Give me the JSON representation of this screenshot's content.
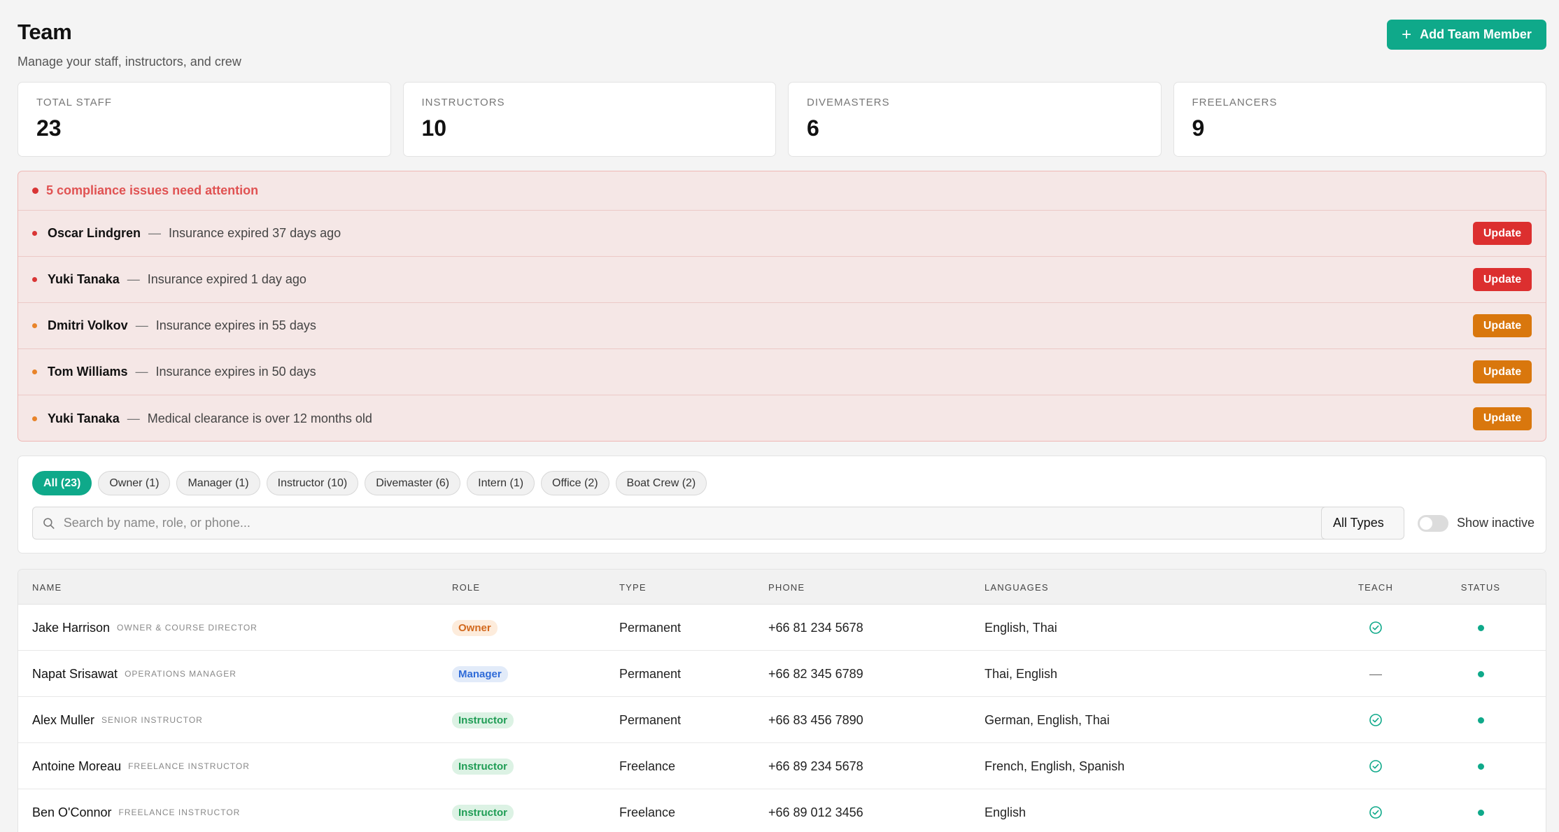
{
  "header": {
    "title": "Team",
    "subtitle": "Manage your staff, instructors, and crew",
    "add_button_label": "Add Team Member"
  },
  "stats": [
    {
      "label": "TOTAL STAFF",
      "value": "23"
    },
    {
      "label": "INSTRUCTORS",
      "value": "10"
    },
    {
      "label": "DIVEMASTERS",
      "value": "6"
    },
    {
      "label": "FREELANCERS",
      "value": "9"
    }
  ],
  "compliance": {
    "headline": "5 compliance issues need attention",
    "issues": [
      {
        "name": "Oscar Lindgren",
        "message": "Insurance expired 37 days ago",
        "severity": "expired",
        "button": "Update"
      },
      {
        "name": "Yuki Tanaka",
        "message": "Insurance expired 1 day ago",
        "severity": "expired",
        "button": "Update"
      },
      {
        "name": "Dmitri Volkov",
        "message": "Insurance expires in 55 days",
        "severity": "warning",
        "button": "Update"
      },
      {
        "name": "Tom Williams",
        "message": "Insurance expires in 50 days",
        "severity": "warning",
        "button": "Update"
      },
      {
        "name": "Yuki Tanaka",
        "message": "Medical clearance is over 12 months old",
        "severity": "warning",
        "button": "Update"
      }
    ]
  },
  "filters": {
    "chips": [
      "All (23)",
      "Owner (1)",
      "Manager (1)",
      "Instructor (10)",
      "Divemaster (6)",
      "Intern (1)",
      "Office (2)",
      "Boat Crew (2)"
    ],
    "active_chip": 0,
    "search_placeholder": "Search by name, role, or phone...",
    "type_select": "All Types",
    "show_inactive_label": "Show inactive",
    "show_inactive": false
  },
  "table": {
    "columns": [
      "NAME",
      "ROLE",
      "TYPE",
      "PHONE",
      "LANGUAGES",
      "TEACH",
      "STATUS"
    ],
    "rows": [
      {
        "name": "Jake Harrison",
        "title": "OWNER & COURSE DIRECTOR",
        "role": "Owner",
        "role_kind": "owner",
        "type": "Permanent",
        "phone": "+66 81 234 5678",
        "languages": "English, Thai",
        "teach": true,
        "active": true
      },
      {
        "name": "Napat Srisawat",
        "title": "OPERATIONS MANAGER",
        "role": "Manager",
        "role_kind": "manager",
        "type": "Permanent",
        "phone": "+66 82 345 6789",
        "languages": "Thai, English",
        "teach": false,
        "active": true
      },
      {
        "name": "Alex Muller",
        "title": "SENIOR INSTRUCTOR",
        "role": "Instructor",
        "role_kind": "instructor",
        "type": "Permanent",
        "phone": "+66 83 456 7890",
        "languages": "German, English, Thai",
        "teach": true,
        "active": true
      },
      {
        "name": "Antoine Moreau",
        "title": "FREELANCE INSTRUCTOR",
        "role": "Instructor",
        "role_kind": "instructor",
        "type": "Freelance",
        "phone": "+66 89 234 5678",
        "languages": "French, English, Spanish",
        "teach": true,
        "active": true
      },
      {
        "name": "Ben O'Connor",
        "title": "FREELANCE INSTRUCTOR",
        "role": "Instructor",
        "role_kind": "instructor",
        "type": "Freelance",
        "phone": "+66 89 012 3456",
        "languages": "English",
        "teach": true,
        "active": true
      }
    ]
  },
  "colors": {
    "accent": "#0fa98a",
    "expired": "#dc2f2f",
    "warning": "#d9770d",
    "expired_dot": "#d93535",
    "warning_dot": "#e8842a"
  },
  "icons": {
    "add": "plus-icon",
    "search": "search-icon",
    "teach_yes": "check-circle-icon",
    "status": "status-dot-icon"
  }
}
